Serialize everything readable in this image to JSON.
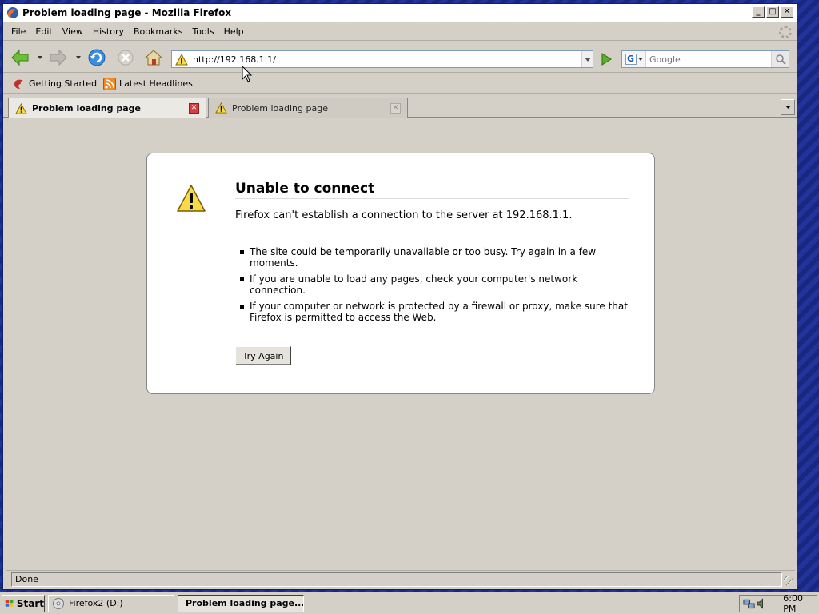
{
  "window": {
    "title": "Problem loading page - Mozilla Firefox",
    "buttons": {
      "minimize": "_",
      "maximize": "□",
      "close": "✕"
    }
  },
  "menu": [
    "File",
    "Edit",
    "View",
    "History",
    "Bookmarks",
    "Tools",
    "Help"
  ],
  "navigation": {
    "url": "http://192.168.1.1/",
    "search_placeholder": "Google",
    "search_engine_letter": "G"
  },
  "bookmarks": [
    {
      "label": "Getting Started",
      "icon": "firefox-bookmark-icon"
    },
    {
      "label": "Latest Headlines",
      "icon": "rss-feed-icon"
    }
  ],
  "tabs": [
    {
      "label": "Problem loading page",
      "active": true
    },
    {
      "label": "Problem loading page",
      "active": false
    }
  ],
  "error_page": {
    "title": "Unable to connect",
    "description": "Firefox can't establish a connection to the server at 192.168.1.1.",
    "reasons": [
      "The site could be temporarily unavailable or too busy. Try again in a few moments.",
      "If you are unable to load any pages, check your computer's network connection.",
      "If your computer or network is protected by a firewall or proxy, make sure that Firefox is permitted to access the Web."
    ],
    "button_label": "Try Again"
  },
  "status": {
    "text": "Done"
  },
  "taskbar": {
    "start_label": "Start",
    "items": [
      {
        "label": "Firefox2 (D:)",
        "active": false
      },
      {
        "label": "Problem loading page...",
        "active": true
      }
    ],
    "clock": "6:00 PM"
  },
  "colors": {
    "window_frame": "#0a246a",
    "chrome_bg": "#d4d0c8",
    "desktop": "#1b2a8a",
    "warning_yellow": "#f7d94a",
    "tab_close_red": "#d84040"
  }
}
